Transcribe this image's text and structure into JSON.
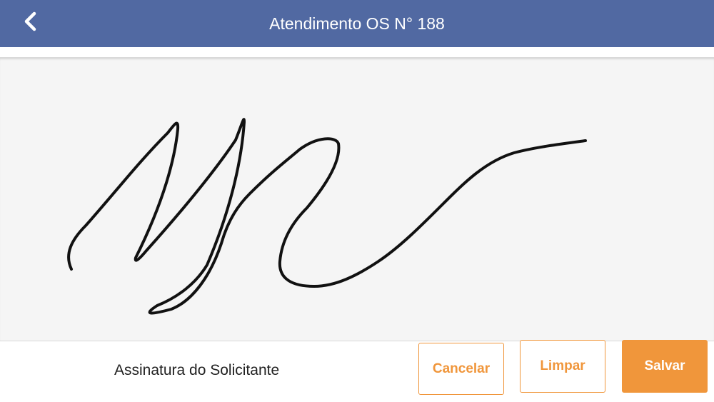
{
  "header": {
    "title": "Atendimento OS N° 188",
    "back_icon": "chevron-left-icon"
  },
  "signature": {
    "caption": "Assinatura do Solicitante",
    "stroke_color": "#111111",
    "has_signature": true
  },
  "actions": {
    "cancel_label": "Cancelar",
    "clear_label": "Limpar",
    "save_label": "Salvar"
  },
  "colors": {
    "nav_bar": "#5169a2",
    "accent": "#f0963b",
    "pad_background": "#f5f5f5"
  }
}
